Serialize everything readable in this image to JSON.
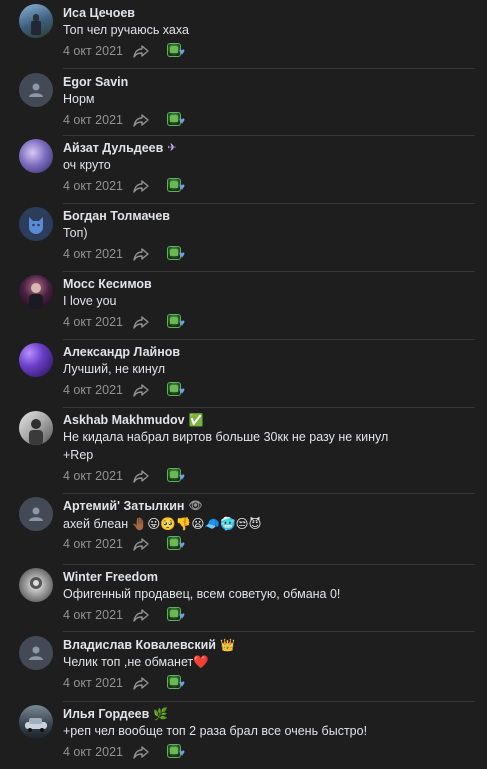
{
  "comments": [
    {
      "author": "Иса Цечоев",
      "text": "Топ чел ручаюсь хаха",
      "date": "4 окт 2021",
      "avatar": "photo-person-outdoor",
      "badge": ""
    },
    {
      "author": "Egor Savin",
      "text": "Норм",
      "date": "4 окт 2021",
      "avatar": "default-user-icon",
      "badge": ""
    },
    {
      "author": "Айзат Дульдеев",
      "text": "оч круто",
      "date": "4 окт 2021",
      "avatar": "photo-purple-night",
      "badge": "✈"
    },
    {
      "author": "Богдан Толмачев",
      "text": "Топ)",
      "date": "4 окт 2021",
      "avatar": "dog-logo-icon",
      "badge": ""
    },
    {
      "author": "Мосс Кесимов",
      "text": "I love you",
      "date": "4 окт 2021",
      "avatar": "photo-person-dark",
      "badge": ""
    },
    {
      "author": "Александр Лайнов",
      "text": "Лучший, не кинул",
      "date": "4 окт 2021",
      "avatar": "photo-purple-abstract",
      "badge": ""
    },
    {
      "author": "Askhab Makhmudov",
      "text": "Не кидала набрал виртов больше 30кк не разу не кинул +Rep",
      "date": "4 окт 2021",
      "avatar": "photo-person-light",
      "badge": "✅"
    },
    {
      "author": "Артемий' Затылкин",
      "text": "ахей блеан 🤚🏾😛🥺👎😦🧢🥶😒😈",
      "date": "4 окт 2021",
      "avatar": "default-user-icon",
      "badge": "👁"
    },
    {
      "author": "Winter Freedom",
      "text": "Офигенный продавец, всем советую, обмана 0!",
      "date": "4 окт 2021",
      "avatar": "photo-grey-portrait",
      "badge": ""
    },
    {
      "author": "Владислав Ковалевский",
      "text": "Челик топ ,не обманет❤️",
      "date": "4 окт 2021",
      "avatar": "default-user-icon",
      "badge": "👑"
    },
    {
      "author": "Илья Гордеев",
      "text": "+реп чел вообще топ 2 раза брал все очень быстро!",
      "date": "4 окт 2021",
      "avatar": "photo-car",
      "badge": "🌿"
    }
  ],
  "colors": {
    "background": "#1e1e1f",
    "text": "#e1e3e6",
    "secondary": "#939393",
    "heart": "#6fa0e8"
  }
}
